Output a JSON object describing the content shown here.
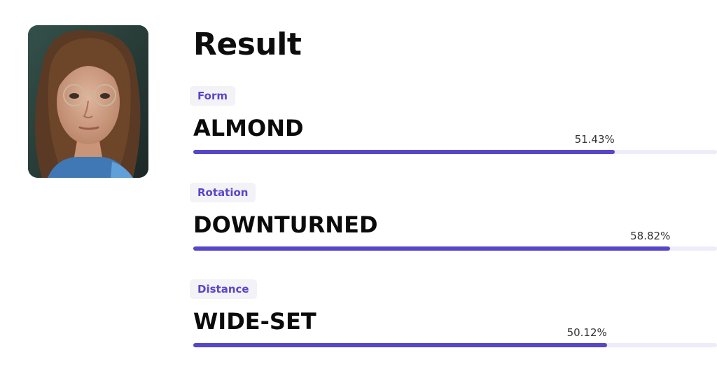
{
  "result": {
    "title": "Result",
    "metrics": [
      {
        "label": "Form",
        "value": "ALMOND",
        "percent_text": "51.43%",
        "fill_fraction": 0.8045
      },
      {
        "label": "Rotation",
        "value": "DOWNTURNED",
        "percent_text": "58.82%",
        "fill_fraction": 0.9109
      },
      {
        "label": "Distance",
        "value": "WIDE-SET",
        "percent_text": "50.12%",
        "fill_fraction": 0.7898
      }
    ]
  },
  "colors": {
    "accent": "#5846c8",
    "badge_bg": "#f3f2f7",
    "badge_text": "#5946c9",
    "track": "#eeecfa"
  },
  "icons": {
    "photo": "portrait-photo"
  }
}
